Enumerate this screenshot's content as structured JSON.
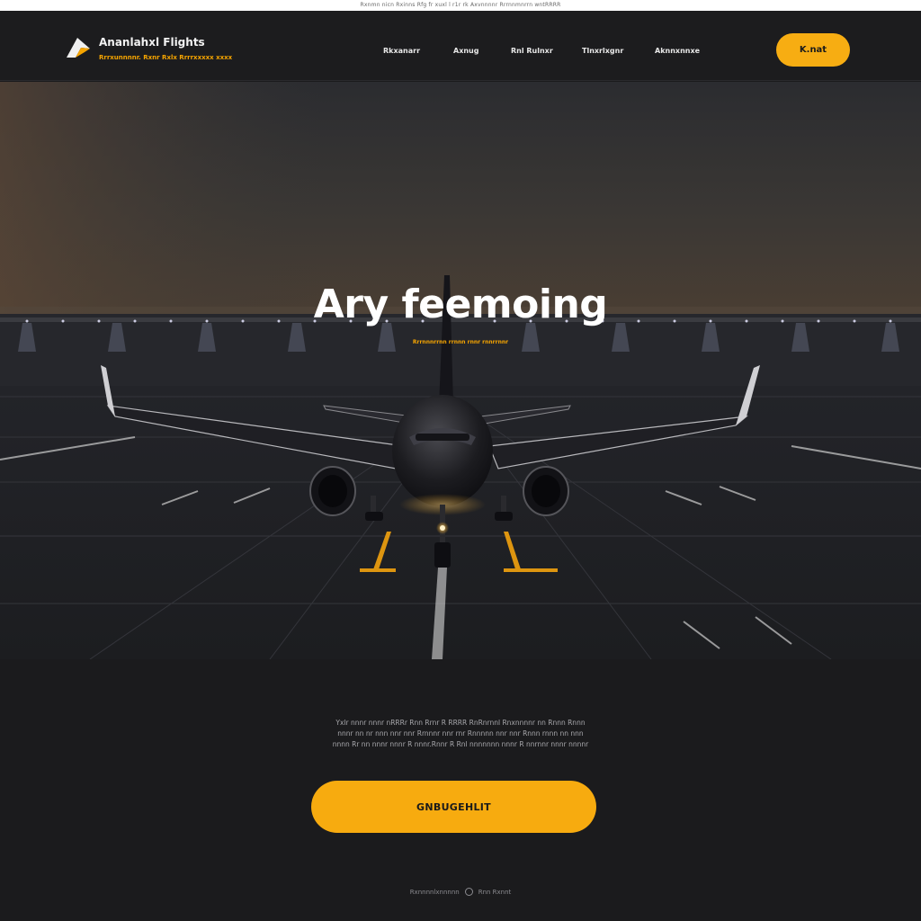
{
  "top_strip": {
    "text": "Rxnmn nicn Rxinns Rfg fr xuxl l r1r rk Axvnnnnr Rrrnnmnrrn wntRRRR"
  },
  "header": {
    "brand_name": "Ananlahxl Flights",
    "tagline": "Rrrxunnnnr. Rxnr Rxlx Rrrrxxxxx xxxx",
    "nav": [
      {
        "label": "Rkxanarr"
      },
      {
        "label": "Axnug"
      },
      {
        "label": "Rnl Rulnxr"
      },
      {
        "label": "Tlnxrlxgnr"
      },
      {
        "label": "Aknnxnnxe"
      }
    ],
    "cta_label": "K.nat"
  },
  "hero": {
    "title": "Ary feemoing",
    "subtitle": "Rrrnnnrrnn rrnnn rnnr rnnrrnnr"
  },
  "content": {
    "description_lines": [
      "Yxlr nnnr nnnr nRRRr Rnn Rrnr R RRRR RnRnrnnl Rnxnnnnr nn Rnnn Rnnn",
      "nnnr nn nr nnn nnr nnr Rrnnnr nnr rnr Rnnnnn nnr nnr Rnnn rnnn nn nnn",
      "nnnn Rr nn nnnr nnnr R nnnr.Rnnr R Rnl nnnnnnn nnnr R nnrnnr nnnr nnnnr"
    ],
    "cta_label": "GNBUGEHLIT",
    "footer_left": "Rxnnnnlxnnnnn",
    "footer_right": "Rnn Rxnnt"
  },
  "colors": {
    "accent": "#f7ab0f",
    "background": "#1b1b1d",
    "text_light": "#ffffff"
  },
  "icons": {
    "logo": "plane-logo-icon",
    "footer": "circle-icon"
  }
}
